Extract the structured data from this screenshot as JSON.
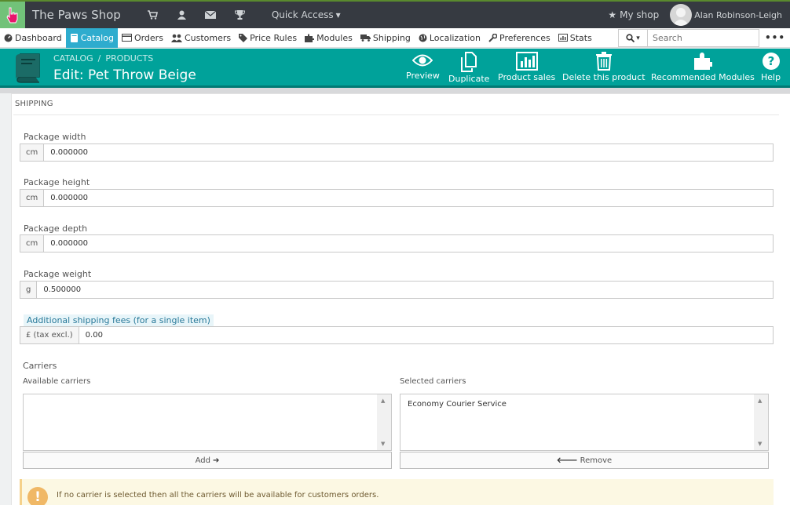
{
  "topbar": {
    "shop_name": "The Paws Shop",
    "quick_access": "Quick Access",
    "my_shop": "My shop",
    "username": "Alan Robinson-Leigh"
  },
  "menu": {
    "items": [
      {
        "label": "Dashboard",
        "icon": "dashboard-icon"
      },
      {
        "label": "Catalog",
        "icon": "catalog-icon",
        "active": true
      },
      {
        "label": "Orders",
        "icon": "orders-icon"
      },
      {
        "label": "Customers",
        "icon": "customers-icon"
      },
      {
        "label": "Price Rules",
        "icon": "price-tag-icon"
      },
      {
        "label": "Modules",
        "icon": "puzzle-icon"
      },
      {
        "label": "Shipping",
        "icon": "truck-icon"
      },
      {
        "label": "Localization",
        "icon": "globe-icon"
      },
      {
        "label": "Preferences",
        "icon": "wrench-icon"
      },
      {
        "label": "Stats",
        "icon": "bar-chart-icon"
      }
    ],
    "search_placeholder": "Search"
  },
  "header": {
    "breadcrumb": [
      "CATALOG",
      "/",
      "PRODUCTS"
    ],
    "title": "Edit: Pet Throw Beige",
    "toolbar": {
      "preview": "Preview",
      "duplicate": "Duplicate",
      "product_sales": "Product sales",
      "delete": "Delete this product",
      "recommended": "Recommended Modules",
      "help": "Help"
    }
  },
  "panel": {
    "heading": "SHIPPING",
    "fields": {
      "width": {
        "label": "Package width",
        "unit": "cm",
        "value": "0.000000"
      },
      "height": {
        "label": "Package height",
        "unit": "cm",
        "value": "0.000000"
      },
      "depth": {
        "label": "Package depth",
        "unit": "cm",
        "value": "0.000000"
      },
      "weight": {
        "label": "Package weight",
        "unit": "g",
        "value": "0.500000"
      },
      "fees": {
        "label": "Additional shipping fees (for a single item)",
        "unit": "£ (tax excl.)",
        "value": "0.00"
      }
    },
    "carriers": {
      "title": "Carriers",
      "available_label": "Available carriers",
      "selected_label": "Selected carriers",
      "selected_items": [
        "Economy Courier Service"
      ],
      "add_label": "Add",
      "remove_label": "Remove"
    },
    "alert": "If no carrier is selected then all the carriers will be available for customers orders."
  }
}
